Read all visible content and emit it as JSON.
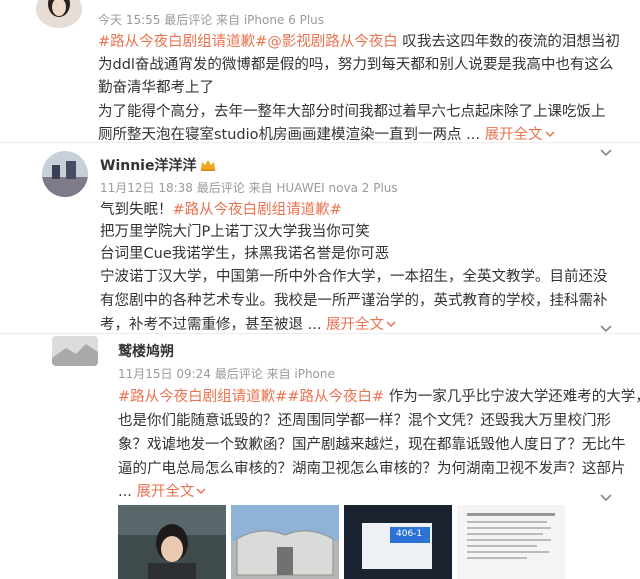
{
  "post1": {
    "meta": "今天 15:55 最后评论 来自 iPhone 6 Plus",
    "l1_tag1": "#路从今夜白剧组请道歉#",
    "l1_tag2": "@影视剧路从今夜白",
    "l1_text": " 叹我去这四年数的夜流的泪想当初",
    "l2": "为ddl奋战通宵发的微博都是假的吗，努力到每天都和别人说要是我高中也有这么",
    "l3": "勤奋清华都考上了",
    "l4": "为了能得个高分，去年一整年大部分时间我都过着早六七点起床除了上课吃饭上",
    "l5": "厕所整天泡在寝室studio机房画画建模渲染一直到一两点 ...",
    "more": "展开全文"
  },
  "post2": {
    "name": "Winnie洋洋洋",
    "meta": "11月12日 18:38 最后评论 来自 HUAWEI nova 2 Plus",
    "l1_text": "气到失眠！",
    "l1_tag": "#路从今夜白剧组请道歉#",
    "l2": "把万里学院大门P上诺丁汉大学我当你可笑",
    "l3": "台词里Cue我诺学生，抹黑我诺名誉是你可恶",
    "l4": "宁波诺丁汉大学，中国第一所中外合作大学，一本招生，全英文教学。目前还没",
    "l5": "有您剧中的各种艺术专业。我校是一所严谨治学的，英式教育的学校，挂科需补",
    "l6": "考，补考不过需重修，甚至被退 ...",
    "more": "展开全文"
  },
  "post3": {
    "name": "鹫楼鸠朔",
    "meta": "11月15日 09:24 最后评论 来自 iPhone",
    "l1_tag1": "#路从今夜白剧组请道歉#",
    "l1_tag2": "#路从今夜白#",
    "l1_text": " 作为一家几乎比宁波大学还难考的大学，",
    "l2": "也是你们能随意诋毁的？还周围同学都一样？混个文凭？还毁我大万里校门形",
    "l3": "象？戏谑地发一个致歉函？国产剧越来越烂，现在都靠诋毁他人度日了？无比牛",
    "l4": "逼的广电总局怎么审核的？湖南卫视怎么审核的？为何湖南卫视不发声？这部片",
    "l5": " ...",
    "more": "展开全文",
    "thumb3_label": "406-1"
  }
}
